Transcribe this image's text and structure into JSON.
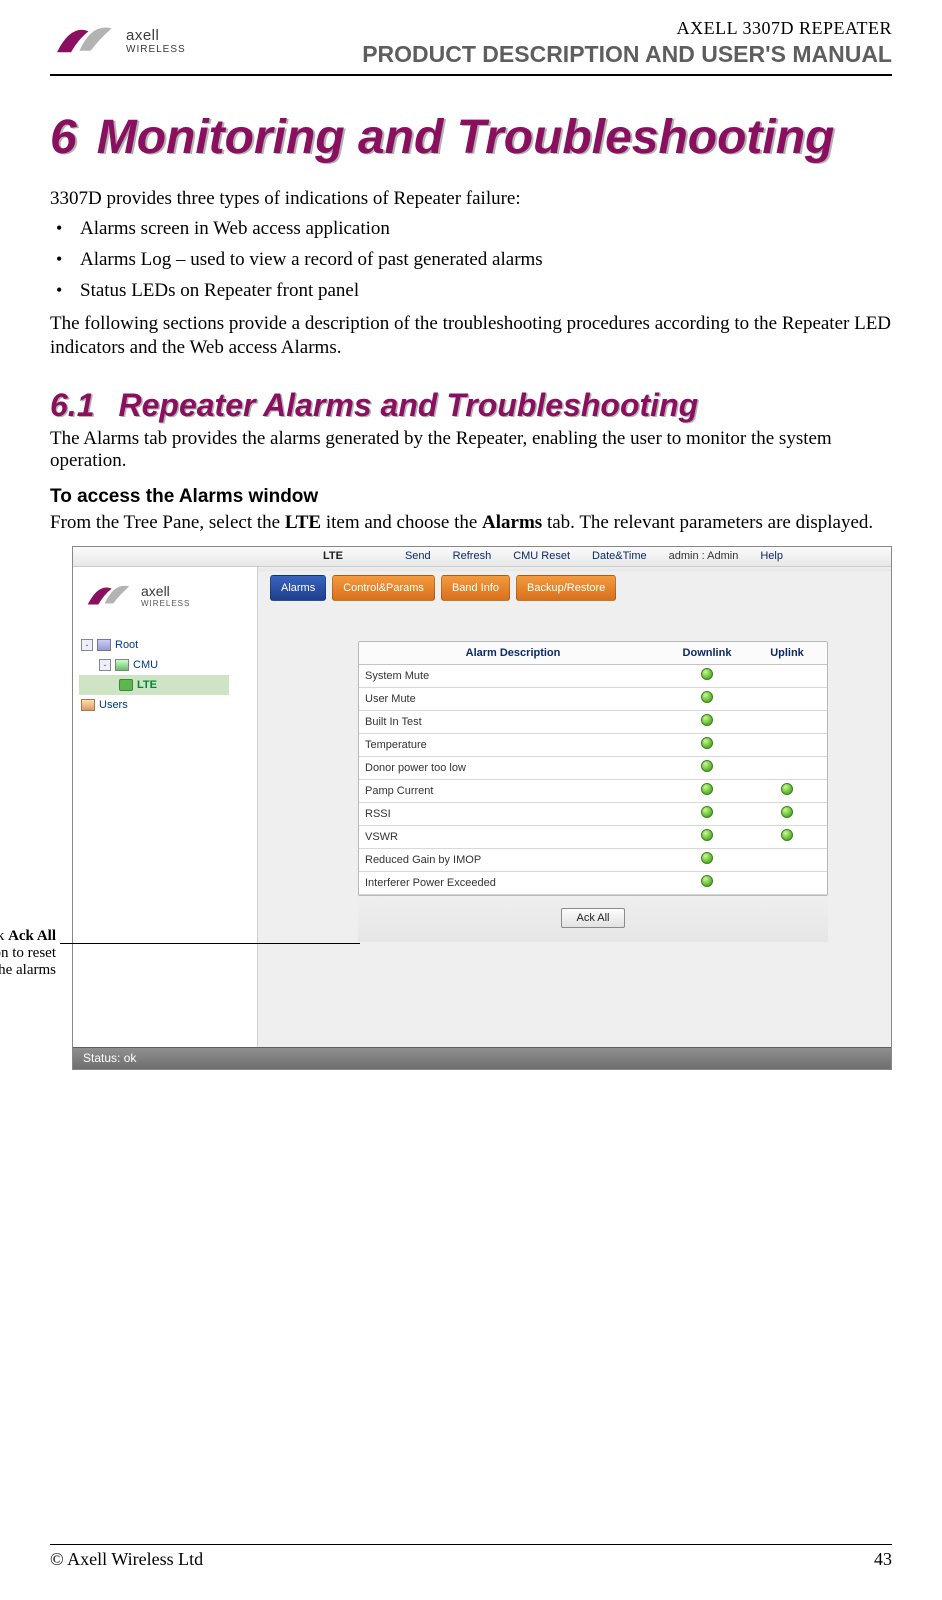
{
  "header": {
    "brand_top": "axell",
    "brand_sub": "WIRELESS",
    "product_code": "AXELL 3307D REPEATER",
    "manual_title": "PRODUCT DESCRIPTION AND USER'S MANUAL"
  },
  "chapter": {
    "number": "6",
    "title": "Monitoring and Troubleshooting"
  },
  "intro": {
    "lead": "3307D provides three types of indications of Repeater failure:",
    "bullets": [
      "Alarms screen in Web access application",
      "Alarms Log – used to view a record of past generated alarms",
      "Status LEDs on Repeater front panel"
    ],
    "after": "The following sections provide a description of the troubleshooting procedures according to the Repeater LED indicators and the Web access Alarms."
  },
  "section": {
    "number": "6.1",
    "title": "Repeater Alarms and Troubleshooting",
    "p1": "The Alarms tab provides the alarms generated by the Repeater, enabling the user to monitor the system operation.",
    "subhead": "To access the Alarms window",
    "p2_a": "From the Tree Pane, select the ",
    "p2_b": "LTE",
    "p2_c": " item and choose the ",
    "p2_d": "Alarms",
    "p2_e": " tab. The relevant parameters are displayed."
  },
  "app": {
    "toolbar": {
      "lte": "LTE",
      "send": "Send",
      "refresh": "Refresh",
      "cmu_reset": "CMU Reset",
      "date_time": "Date&Time",
      "user": "admin : Admin",
      "help": "Help"
    },
    "tabs": {
      "alarms": "Alarms",
      "control": "Control&Params",
      "band": "Band Info",
      "backup": "Backup/Restore"
    },
    "tree": {
      "root": "Root",
      "cmu": "CMU",
      "lte": "LTE",
      "users": "Users"
    },
    "alarm_table": {
      "head_desc": "Alarm Description",
      "head_dl": "Downlink",
      "head_ul": "Uplink",
      "rows": [
        {
          "name": "System Mute",
          "dl": true,
          "ul": false
        },
        {
          "name": "User Mute",
          "dl": true,
          "ul": false
        },
        {
          "name": "Built In Test",
          "dl": true,
          "ul": false
        },
        {
          "name": "Temperature",
          "dl": true,
          "ul": false
        },
        {
          "name": "Donor power too low",
          "dl": true,
          "ul": false
        },
        {
          "name": "Pamp Current",
          "dl": true,
          "ul": true
        },
        {
          "name": "RSSI",
          "dl": true,
          "ul": true
        },
        {
          "name": "VSWR",
          "dl": true,
          "ul": true
        },
        {
          "name": "Reduced Gain by IMOP",
          "dl": true,
          "ul": false
        },
        {
          "name": "Interferer Power Exceeded",
          "dl": true,
          "ul": false
        }
      ],
      "ack_all": "Ack All"
    },
    "status": "Status: ok"
  },
  "callout": {
    "l1a": "Click ",
    "l1b": "Ack All",
    "l2": "button to reset",
    "l3": "the alarms"
  },
  "footer": {
    "left": "© Axell Wireless Ltd",
    "right": "43"
  }
}
